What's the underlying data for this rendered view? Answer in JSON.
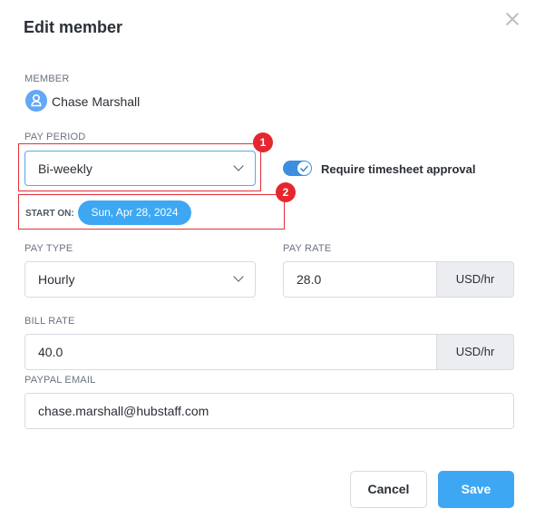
{
  "dialog": {
    "title": "Edit member"
  },
  "member": {
    "label": "MEMBER",
    "name": "Chase Marshall"
  },
  "pay_period": {
    "label": "PAY PERIOD",
    "value": "Bi-weekly",
    "annotation": "1"
  },
  "timesheet_toggle": {
    "label": "Require timesheet approval",
    "on": true,
    "color": "#3d8de0"
  },
  "start_on": {
    "label": "START ON:",
    "date": "Sun, Apr 28, 2024",
    "annotation": "2"
  },
  "pay_type": {
    "label": "PAY TYPE",
    "value": "Hourly"
  },
  "pay_rate": {
    "label": "PAY RATE",
    "value": "28.0",
    "unit": "USD/hr"
  },
  "bill_rate": {
    "label": "BILL RATE",
    "value": "40.0",
    "unit": "USD/hr"
  },
  "paypal_email": {
    "label": "PAYPAL EMAIL",
    "value": "chase.marshall@hubstaff.com"
  },
  "footer": {
    "cancel_label": "Cancel",
    "save_label": "Save"
  },
  "colors": {
    "accent": "#3ea7f3",
    "highlight": "#e0313b"
  }
}
